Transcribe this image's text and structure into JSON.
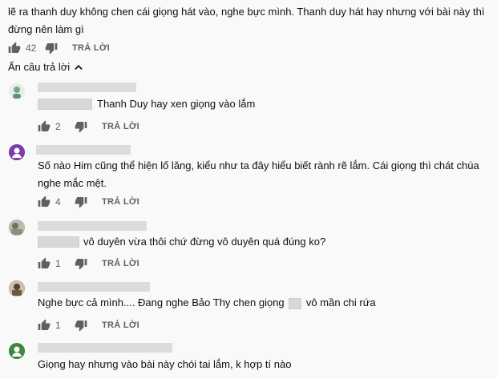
{
  "top_comment": {
    "text": "lẽ ra thanh duy không chen cái giọng hát vào, nghe bực mình. Thanh duy hát hay nhưng với bài này thì đừng nên làm gì",
    "likes": "42",
    "reply_label": "TRẢ LỜI"
  },
  "hide_replies": {
    "label": "Ẩn câu trả lời"
  },
  "replies": [
    {
      "text": "Thanh Duy hay xen giọng vào lắm",
      "likes": "2",
      "reply_label": "TRẢ LỜI",
      "avatar_color": "#e8efe9",
      "avatar_icon": "person-avatar"
    },
    {
      "text": "Số nào Him cũng thể hiện lố lăng, kiểu như ta đây hiểu biết rành rẽ lắm. Cái giọng thì chát chúa nghe mắc mệt.",
      "likes": "4",
      "reply_label": "TRẢ LỜI",
      "avatar_color": "#7b3ea8",
      "avatar_icon": "person-silhouette"
    },
    {
      "text": "vô duyên vừa thôi chứ đừng vô duyên quá đúng ko?",
      "likes": "1",
      "reply_label": "TRẢ LỜI",
      "avatar_color": "#8a8f7a",
      "avatar_icon": "photo-avatar"
    },
    {
      "text_before": "Nghe bực cả mình.... Đang nghe Bảo Thy chen giọng",
      "text_after": "vô mần chi rứa",
      "likes": "1",
      "reply_label": "TRẢ LỜI",
      "avatar_color": "#6a5a40",
      "avatar_icon": "photo-avatar"
    },
    {
      "text": "Giọng hay nhưng vào bài này chói tai lắm, k hợp tí nào",
      "avatar_color": "#3d8a3d",
      "avatar_icon": "person-silhouette"
    }
  ],
  "colors": {
    "text": "#0f0f0f",
    "secondary": "#606060",
    "background": "#f9f9f9"
  }
}
